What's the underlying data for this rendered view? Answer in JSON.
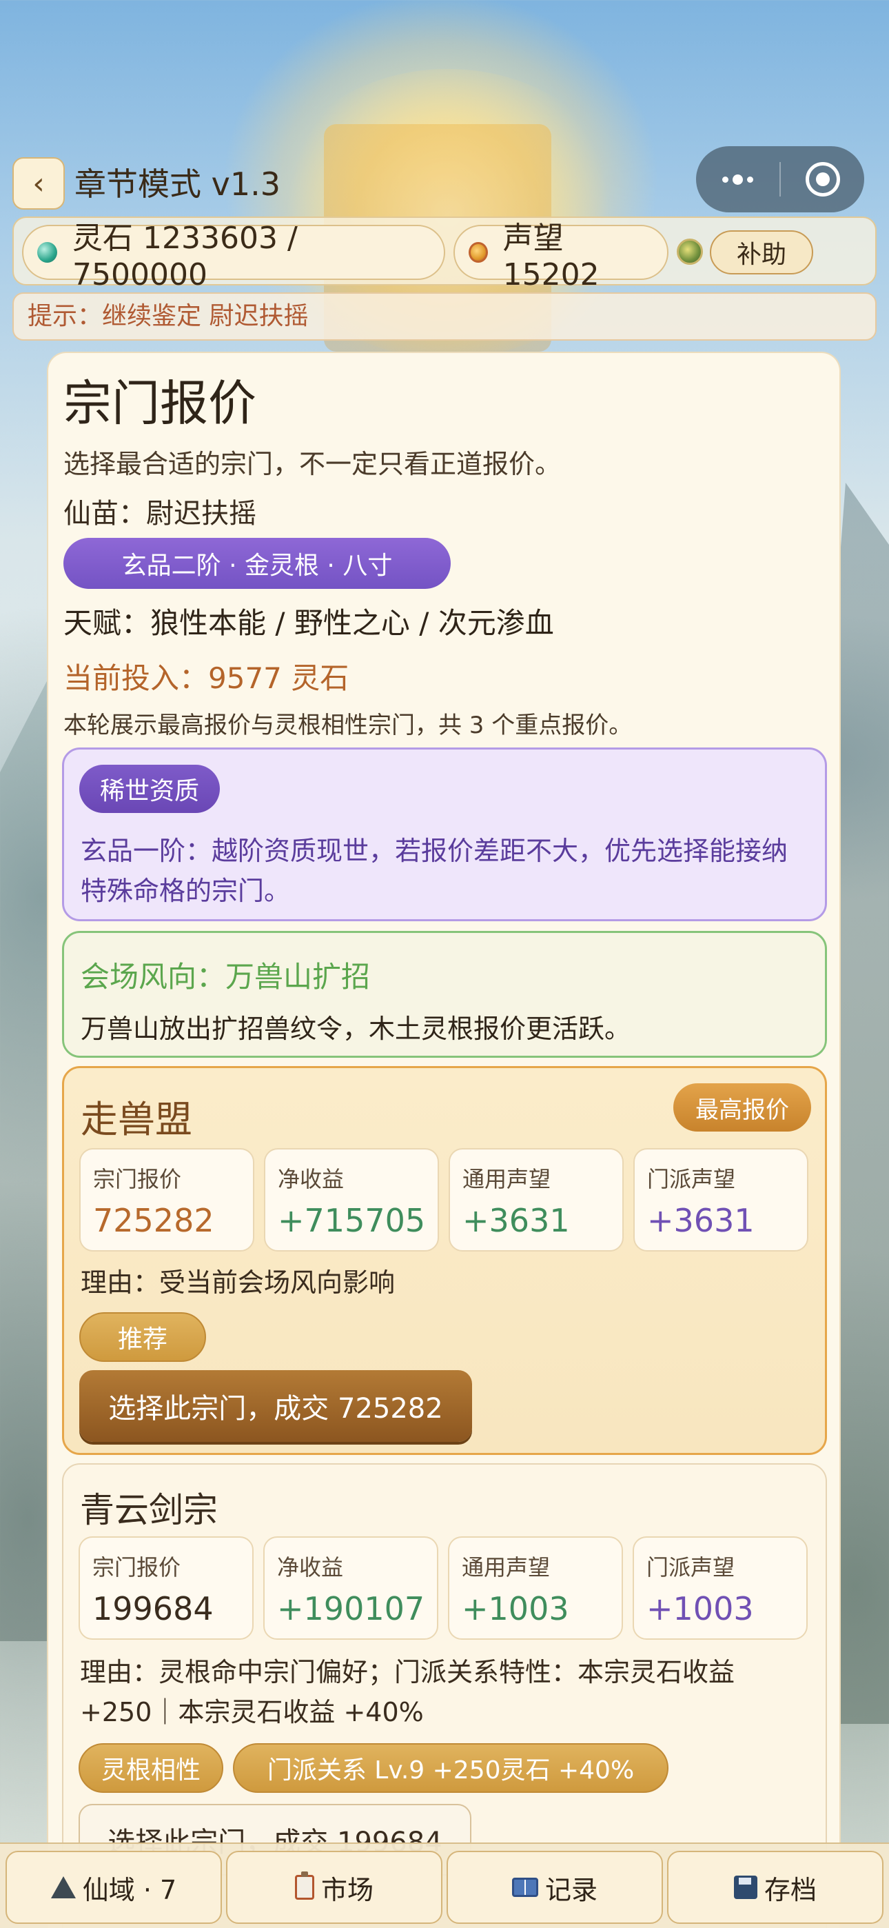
{
  "header": {
    "back_glyph": "‹",
    "title": "章节模式 v1.3"
  },
  "resources": {
    "spirit_stone_text": "灵石 1233603 / 7500000",
    "reputation_text": "声望 15202",
    "assist_label": "补助"
  },
  "hint": "提示：继续鉴定 尉迟扶摇",
  "panel": {
    "title": "宗门报价",
    "subtitle": "选择最合适的宗门，不一定只看正道报价。",
    "seedling": "仙苗：尉迟扶摇",
    "grade": "玄品二阶 · 金灵根 · 八寸",
    "talent": "天赋：狼性本能 / 野性之心 / 次元渗血",
    "investment": "当前投入：9577 灵石",
    "note": "本轮展示最高报价与灵根相性宗门，共 3 个重点报价。"
  },
  "rare": {
    "badge": "稀世资质",
    "text": "玄品一阶：越阶资质现世，若报价差距不大，优先选择能接纳特殊命格的宗门。"
  },
  "wind": {
    "title": "会场风向：万兽山扩招",
    "text": "万兽山放出扩招兽纹令，木土灵根报价更活跃。"
  },
  "offers": [
    {
      "name": "走兽盟",
      "badge": "最高报价",
      "stats": [
        {
          "label": "宗门报价",
          "value": "725282"
        },
        {
          "label": "净收益",
          "value": "+715705"
        },
        {
          "label": "通用声望",
          "value": "+3631"
        },
        {
          "label": "门派声望",
          "value": "+3631"
        }
      ],
      "reason": "理由：受当前会场风向影响",
      "tags": [
        "推荐"
      ],
      "choose_label": "选择此宗门，成交 725282"
    },
    {
      "name": "青云剑宗",
      "stats": [
        {
          "label": "宗门报价",
          "value": "199684"
        },
        {
          "label": "净收益",
          "value": "+190107"
        },
        {
          "label": "通用声望",
          "value": "+1003"
        },
        {
          "label": "门派声望",
          "value": "+1003"
        }
      ],
      "reason_line1": "理由：灵根命中宗门偏好；门派关系特性：本宗灵石收益",
      "reason_line2": "+250｜本宗灵石收益 +40%",
      "tags": [
        "灵根相性",
        "门派关系 Lv.9 +250灵石 +40%"
      ],
      "choose_label": "选择此宗门，成交 199684"
    }
  ],
  "bottom_nav": [
    {
      "icon": "mountain-icon",
      "label": "仙域 · 7"
    },
    {
      "icon": "clipboard-icon",
      "label": "市场"
    },
    {
      "icon": "book-icon",
      "label": "记录"
    },
    {
      "icon": "disk-icon",
      "label": "存档"
    }
  ],
  "colors": {
    "accent_purple": "#7453c4",
    "accent_gold": "#c8832c",
    "accent_green": "#5ba64d",
    "text_brown": "#b4642a"
  }
}
